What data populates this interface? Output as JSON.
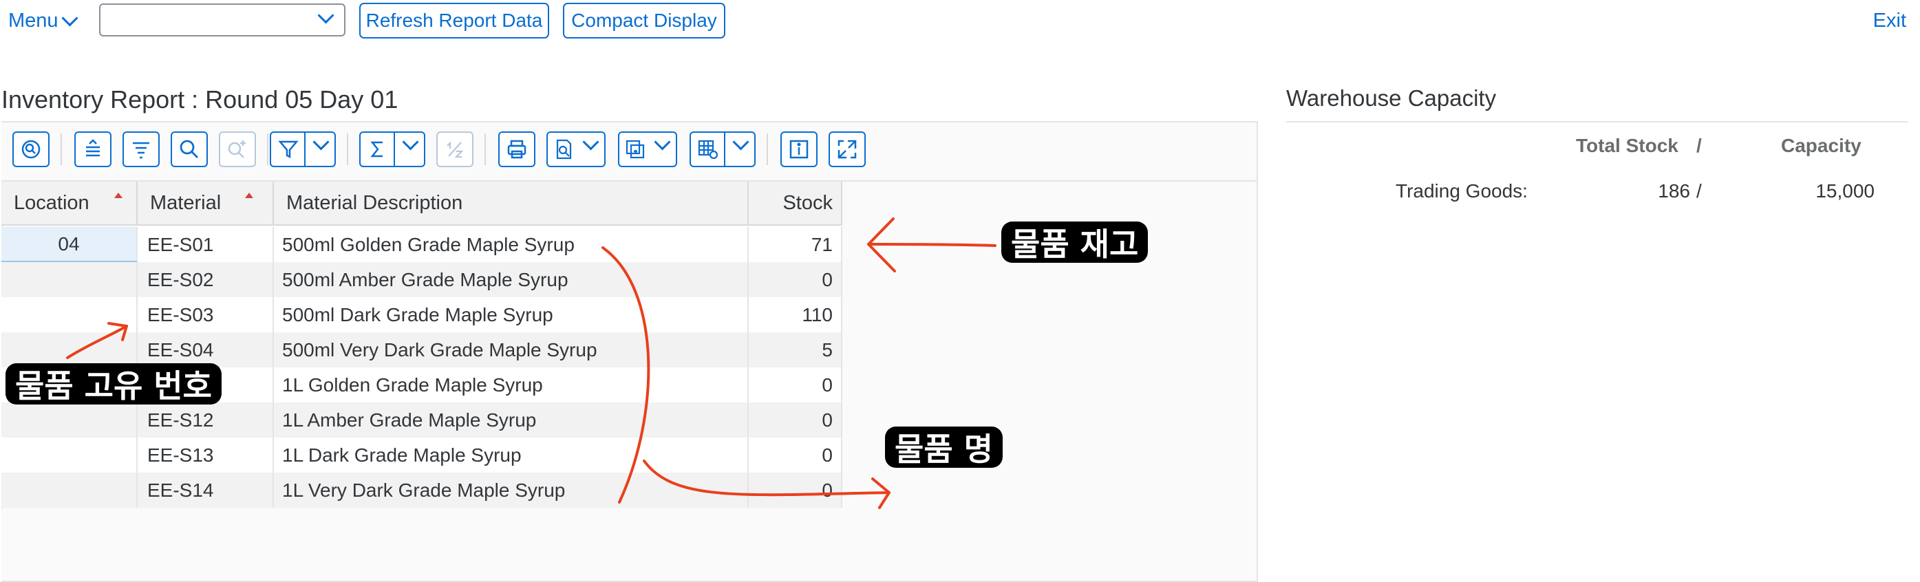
{
  "toolbar": {
    "menu_label": "Menu",
    "variant_value": "",
    "refresh_label": "Refresh Report Data",
    "compact_label": "Compact Display",
    "exit_label": "Exit"
  },
  "report": {
    "title": "Inventory Report : Round 05 Day 01",
    "icons": [
      "zoom-details-icon",
      "sort-ascending-icon",
      "sort-descending-icon",
      "search-icon",
      "search-next-icon",
      "filter-icon",
      "sum-icon",
      "subtotal-icon",
      "print-icon",
      "export-icon",
      "layout-icon",
      "table-settings-icon",
      "info-icon",
      "fullscreen-icon"
    ],
    "columns": {
      "location": "Location",
      "material": "Material",
      "description": "Material Description",
      "stock": "Stock"
    },
    "rows": [
      {
        "location": "04",
        "material": "EE-S01",
        "description": "500ml Golden Grade Maple Syrup",
        "stock": "71"
      },
      {
        "location": "",
        "material": "EE-S02",
        "description": "500ml Amber Grade Maple Syrup",
        "stock": "0"
      },
      {
        "location": "",
        "material": "EE-S03",
        "description": "500ml Dark Grade Maple Syrup",
        "stock": "110"
      },
      {
        "location": "",
        "material": "EE-S04",
        "description": "500ml Very Dark Grade Maple Syrup",
        "stock": "5"
      },
      {
        "location": "",
        "material": "",
        "description": "1L Golden Grade Maple Syrup",
        "stock": "0"
      },
      {
        "location": "",
        "material": "EE-S12",
        "description": "1L Amber Grade Maple Syrup",
        "stock": "0"
      },
      {
        "location": "",
        "material": "EE-S13",
        "description": "1L Dark Grade Maple Syrup",
        "stock": "0"
      },
      {
        "location": "",
        "material": "EE-S14",
        "description": "1L Very Dark Grade Maple Syrup",
        "stock": "0"
      }
    ]
  },
  "capacity": {
    "title": "Warehouse Capacity",
    "header_total": "Total Stock",
    "header_sep": "/",
    "header_capacity": "Capacity",
    "row_label": "Trading Goods:",
    "row_total": "186",
    "row_sep": "/",
    "row_capacity": "15,000"
  },
  "annotations": {
    "stock_label": "물품 재고",
    "material_id_label": "물품 고유 번호",
    "material_name_label": "물품 명",
    "arrow_color": "#e8401c"
  },
  "colors": {
    "accent": "#0a6ed1",
    "text": "#32363a",
    "selected_cell": "#e5f0fa"
  }
}
